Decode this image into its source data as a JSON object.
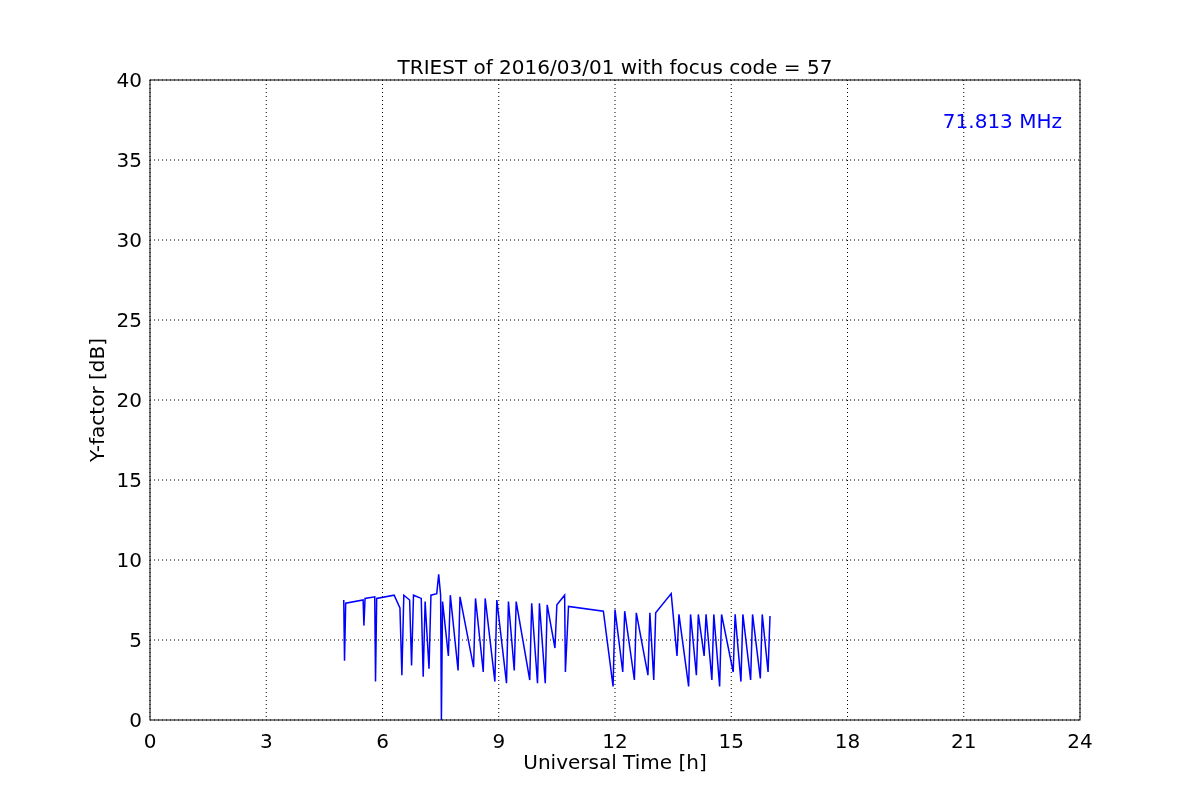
{
  "chart_data": {
    "type": "line",
    "title": "TRIEST of 2016/03/01 with focus code = 57",
    "xlabel": "Universal Time [h]",
    "ylabel": "Y-factor [dB]",
    "xlim": [
      0,
      24
    ],
    "ylim": [
      0,
      40
    ],
    "xticks": [
      0,
      3,
      6,
      9,
      12,
      15,
      18,
      21,
      24
    ],
    "yticks": [
      0,
      5,
      10,
      15,
      20,
      25,
      30,
      35,
      40
    ],
    "x": [
      5.0,
      5.02,
      5.05,
      5.5,
      5.52,
      5.55,
      5.8,
      5.82,
      5.85,
      6.3,
      6.45,
      6.5,
      6.55,
      6.7,
      6.75,
      6.8,
      7.0,
      7.05,
      7.1,
      7.2,
      7.25,
      7.4,
      7.45,
      7.5,
      7.52,
      7.55,
      7.7,
      7.75,
      7.95,
      8.0,
      8.35,
      8.4,
      8.6,
      8.65,
      8.9,
      8.95,
      9.2,
      9.25,
      9.4,
      9.45,
      9.8,
      9.85,
      10.0,
      10.05,
      10.2,
      10.25,
      10.45,
      10.5,
      10.7,
      10.72,
      10.8,
      11.7,
      11.95,
      12.0,
      12.2,
      12.25,
      12.5,
      12.55,
      12.85,
      12.9,
      13.0,
      13.05,
      13.45,
      13.5,
      13.6,
      13.65,
      13.9,
      13.95,
      14.1,
      14.15,
      14.3,
      14.35,
      14.5,
      14.55,
      14.7,
      14.75,
      15.05,
      15.1,
      15.25,
      15.3,
      15.5,
      15.55,
      15.75,
      15.8,
      15.95,
      16.0
    ],
    "series": [
      {
        "name": "71.813 MHz",
        "color": "#0000ff",
        "values": [
          7.5,
          3.7,
          7.3,
          7.5,
          5.9,
          7.6,
          7.7,
          2.4,
          7.6,
          7.8,
          7.0,
          2.8,
          7.8,
          7.5,
          3.4,
          7.8,
          7.6,
          2.7,
          7.4,
          3.2,
          7.8,
          7.9,
          9.1,
          7.8,
          0,
          7.4,
          4.0,
          7.8,
          3.1,
          7.7,
          3.3,
          7.6,
          3.0,
          7.6,
          2.4,
          7.5,
          2.3,
          7.4,
          3.1,
          7.4,
          2.5,
          7.3,
          2.3,
          7.3,
          2.3,
          7.2,
          4.5,
          7.2,
          7.8,
          3.0,
          7.1,
          6.8,
          2.1,
          6.9,
          3.0,
          6.8,
          2.5,
          6.7,
          2.8,
          6.7,
          2.5,
          6.7,
          7.9,
          6.6,
          4.0,
          6.6,
          2.1,
          6.6,
          2.8,
          6.6,
          4.0,
          6.6,
          2.5,
          6.6,
          2.1,
          6.6,
          3.0,
          6.6,
          2.4,
          6.6,
          2.5,
          6.6,
          2.6,
          6.6,
          3.0,
          6.5
        ]
      }
    ],
    "grid": true
  }
}
